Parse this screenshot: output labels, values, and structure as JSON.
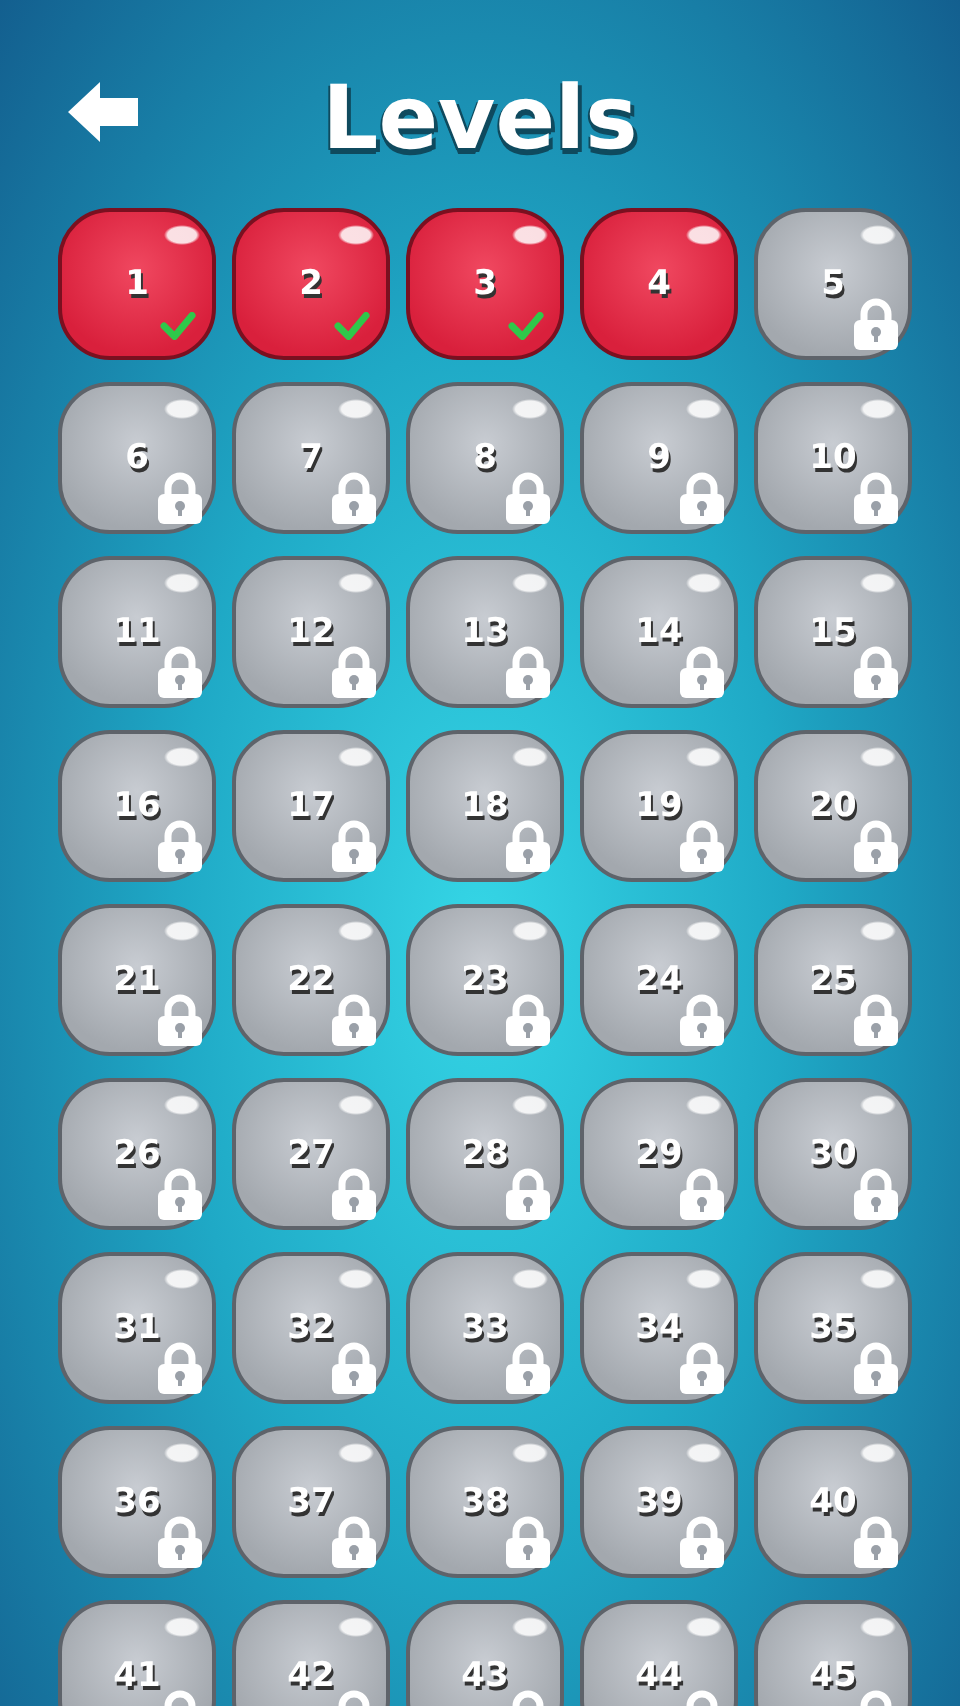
{
  "header": {
    "title": "Levels"
  },
  "levels": [
    {
      "number": "1",
      "kind": "completed"
    },
    {
      "number": "2",
      "kind": "completed"
    },
    {
      "number": "3",
      "kind": "completed"
    },
    {
      "number": "4",
      "kind": "unlocked"
    },
    {
      "number": "5",
      "kind": "locked"
    },
    {
      "number": "6",
      "kind": "locked"
    },
    {
      "number": "7",
      "kind": "locked"
    },
    {
      "number": "8",
      "kind": "locked"
    },
    {
      "number": "9",
      "kind": "locked"
    },
    {
      "number": "10",
      "kind": "locked"
    },
    {
      "number": "11",
      "kind": "locked"
    },
    {
      "number": "12",
      "kind": "locked"
    },
    {
      "number": "13",
      "kind": "locked"
    },
    {
      "number": "14",
      "kind": "locked"
    },
    {
      "number": "15",
      "kind": "locked"
    },
    {
      "number": "16",
      "kind": "locked"
    },
    {
      "number": "17",
      "kind": "locked"
    },
    {
      "number": "18",
      "kind": "locked"
    },
    {
      "number": "19",
      "kind": "locked"
    },
    {
      "number": "20",
      "kind": "locked"
    },
    {
      "number": "21",
      "kind": "locked"
    },
    {
      "number": "22",
      "kind": "locked"
    },
    {
      "number": "23",
      "kind": "locked"
    },
    {
      "number": "24",
      "kind": "locked"
    },
    {
      "number": "25",
      "kind": "locked"
    },
    {
      "number": "26",
      "kind": "locked"
    },
    {
      "number": "27",
      "kind": "locked"
    },
    {
      "number": "28",
      "kind": "locked"
    },
    {
      "number": "29",
      "kind": "locked"
    },
    {
      "number": "30",
      "kind": "locked"
    },
    {
      "number": "31",
      "kind": "locked"
    },
    {
      "number": "32",
      "kind": "locked"
    },
    {
      "number": "33",
      "kind": "locked"
    },
    {
      "number": "34",
      "kind": "locked"
    },
    {
      "number": "35",
      "kind": "locked"
    },
    {
      "number": "36",
      "kind": "locked"
    },
    {
      "number": "37",
      "kind": "locked"
    },
    {
      "number": "38",
      "kind": "locked"
    },
    {
      "number": "39",
      "kind": "locked"
    },
    {
      "number": "40",
      "kind": "locked"
    },
    {
      "number": "41",
      "kind": "locked"
    },
    {
      "number": "42",
      "kind": "locked"
    },
    {
      "number": "43",
      "kind": "locked"
    },
    {
      "number": "44",
      "kind": "locked"
    },
    {
      "number": "45",
      "kind": "locked"
    }
  ]
}
